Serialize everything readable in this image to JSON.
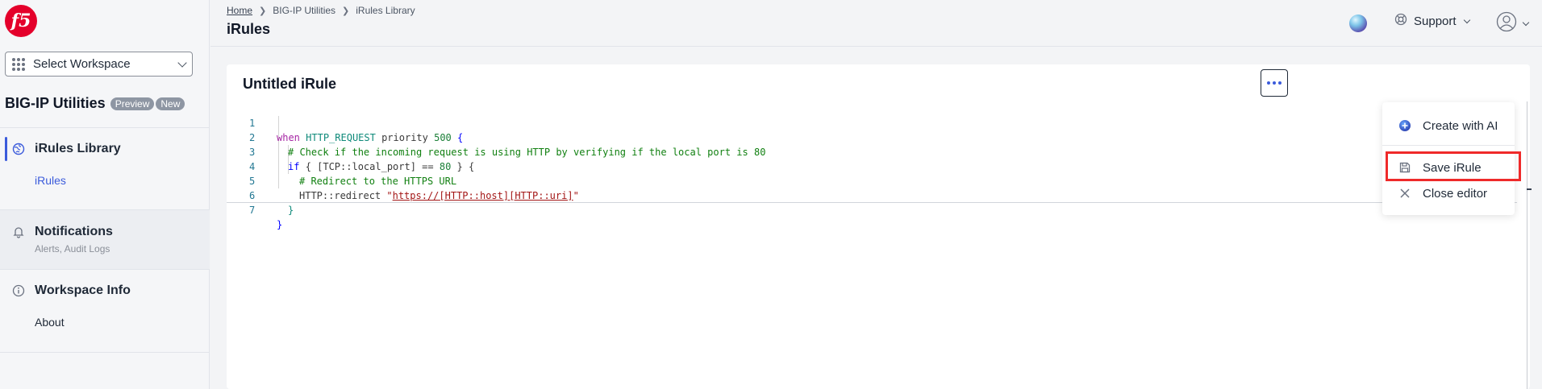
{
  "sidebar": {
    "logo_text": "f5",
    "workspace_select": {
      "value": "Select Workspace"
    },
    "app_title": "BIG-IP Utilities",
    "badges": [
      "Preview",
      "New"
    ],
    "nav": [
      {
        "label": "iRules Library",
        "sub": [
          "iRules"
        ],
        "icon": "globe-icon",
        "active": true
      },
      {
        "label": "Notifications",
        "description": "Alerts, Audit Logs",
        "icon": "bell-icon"
      },
      {
        "label": "Workspace Info",
        "sub": [
          "About"
        ],
        "icon": "info-icon"
      }
    ]
  },
  "header": {
    "breadcrumbs": [
      "Home",
      "BIG-IP Utilities",
      "iRules Library"
    ],
    "title": "iRules",
    "support_label": "Support"
  },
  "editor": {
    "title": "Untitled iRule",
    "line_numbers": [
      "1",
      "2",
      "3",
      "4",
      "5",
      "6",
      "7"
    ],
    "code": {
      "l1": {
        "when": "when",
        "event": "HTTP_REQUEST",
        "priority": "priority",
        "num": "500",
        "brace": "{"
      },
      "l2": "# Check if the incoming request is using HTTP by verifying if the local port is 80",
      "l3": {
        "if": "if",
        "open": "{ [TCP::local_port] == ",
        "num": "80",
        "close": " } {"
      },
      "l4": "# Redirect to the HTTPS URL",
      "l5": {
        "cmd": "HTTP::redirect ",
        "q1": "\"",
        "url1": "https://",
        "url2": "[HTTP::host]",
        "url3": "[HTTP::uri]",
        "q2": "\""
      },
      "l6": "}",
      "l7": "}"
    }
  },
  "menu": {
    "items": [
      {
        "label": "Create with AI",
        "icon": "ai-plus-icon"
      },
      {
        "label": "Save iRule",
        "icon": "save-icon",
        "highlighted": true
      },
      {
        "label": "Close editor",
        "icon": "close-icon"
      }
    ]
  },
  "colors": {
    "accent": "#3b5bdb",
    "logo": "#e4002b",
    "highlight": "#ef2a2a"
  }
}
